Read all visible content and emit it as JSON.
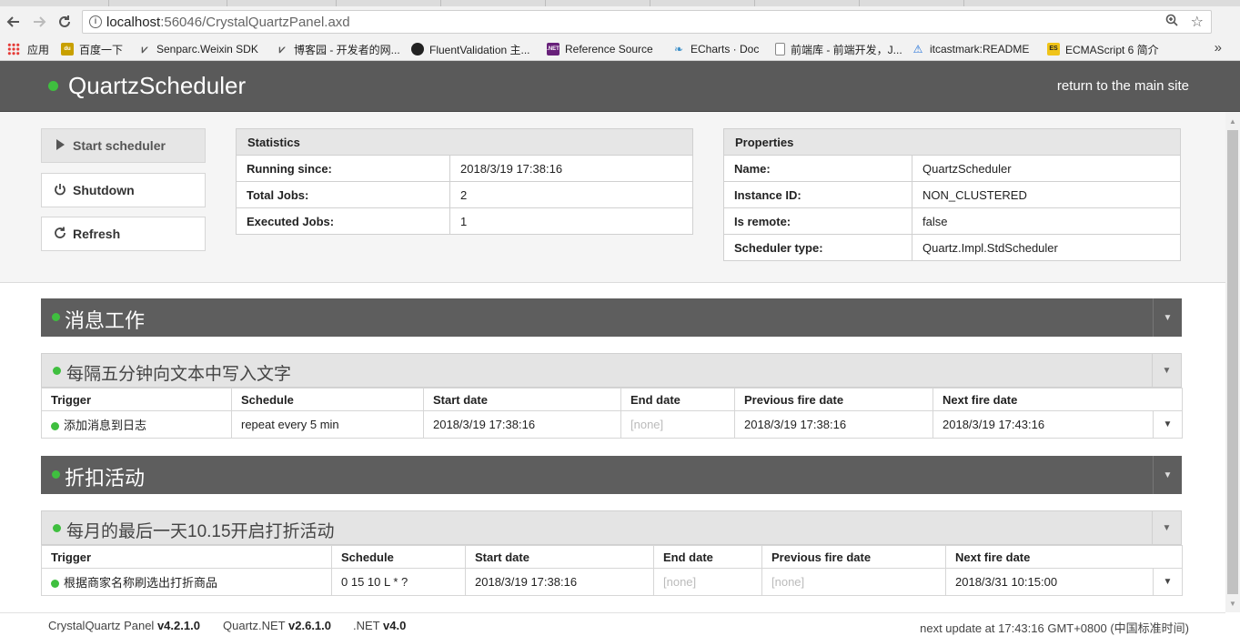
{
  "browser": {
    "url_host": "localhost",
    "url_rest": ":56046/CrystalQuartzPanel.axd",
    "bookmarks": [
      {
        "label": "应用",
        "icon": "apps-grid-icon",
        "color": "#e53935"
      },
      {
        "label": "百度一下",
        "icon": "baidu-icon",
        "color": "#c8a000"
      },
      {
        "label": "Senparc.Weixin SDK",
        "icon": "senparc-icon",
        "color": "#555555"
      },
      {
        "label": "博客园 - 开发者的网...",
        "icon": "cnblogs-icon",
        "color": "#555555"
      },
      {
        "label": "FluentValidation 主...",
        "icon": "github-icon",
        "color": "#222222"
      },
      {
        "label": "Reference Source",
        "icon": "dotnet-icon",
        "color": "#68217a"
      },
      {
        "label": "ECharts · Doc",
        "icon": "echarts-icon",
        "color": "#3a8ec8"
      },
      {
        "label": "前端库 - 前端开发，J...",
        "icon": "page-icon",
        "color": "#888888"
      },
      {
        "label": "itcastmark:README",
        "icon": "itcast-icon",
        "color": "#1e6fd9"
      },
      {
        "label": "ECMAScript 6 简介",
        "icon": "es-icon",
        "color": "#f0c419"
      }
    ]
  },
  "header": {
    "brand": "QuartzScheduler",
    "return_link": "return to the main site"
  },
  "commands": {
    "start": "Start scheduler",
    "shutdown": "Shutdown",
    "refresh": "Refresh"
  },
  "statistics": {
    "title": "Statistics",
    "rows": [
      {
        "key": "Running since:",
        "value": "2018/3/19 17:38:16"
      },
      {
        "key": "Total Jobs:",
        "value": "2"
      },
      {
        "key": "Executed Jobs:",
        "value": "1"
      }
    ]
  },
  "properties": {
    "title": "Properties",
    "rows": [
      {
        "key": "Name:",
        "value": "QuartzScheduler"
      },
      {
        "key": "Instance ID:",
        "value": "NON_CLUSTERED"
      },
      {
        "key": "Is remote:",
        "value": "false"
      },
      {
        "key": "Scheduler type:",
        "value": "Quartz.Impl.StdScheduler"
      }
    ]
  },
  "columns": {
    "trigger": "Trigger",
    "schedule": "Schedule",
    "start": "Start date",
    "end": "End date",
    "prev": "Previous fire date",
    "next": "Next fire date"
  },
  "groups": [
    {
      "name": "消息工作",
      "job": {
        "name": "每隔五分钟向文本中写入文字",
        "trigger": {
          "name": "添加消息到日志",
          "schedule": "repeat every 5 min",
          "start": "2018/3/19 17:38:16",
          "end": "[none]",
          "prev": "2018/3/19 17:38:16",
          "next": "2018/3/19 17:43:16"
        }
      }
    },
    {
      "name": "折扣活动",
      "job": {
        "name": "每月的最后一天10.15开启打折活动",
        "trigger": {
          "name": "根据商家名称刷选出打折商品",
          "schedule": "0 15 10 L * ?",
          "start": "2018/3/19 17:38:16",
          "end": "[none]",
          "prev": "[none]",
          "next": "2018/3/31 10:15:00"
        }
      }
    }
  ],
  "footer": {
    "panel_label": "CrystalQuartz Panel",
    "panel_version": "v4.2.1.0",
    "quartz_label": "Quartz.NET",
    "quartz_version": "v2.6.1.0",
    "net_label": ".NET",
    "net_version": "v4.0",
    "next_update": "next update at 17:43:16 GMT+0800 (中国标准时间)"
  }
}
